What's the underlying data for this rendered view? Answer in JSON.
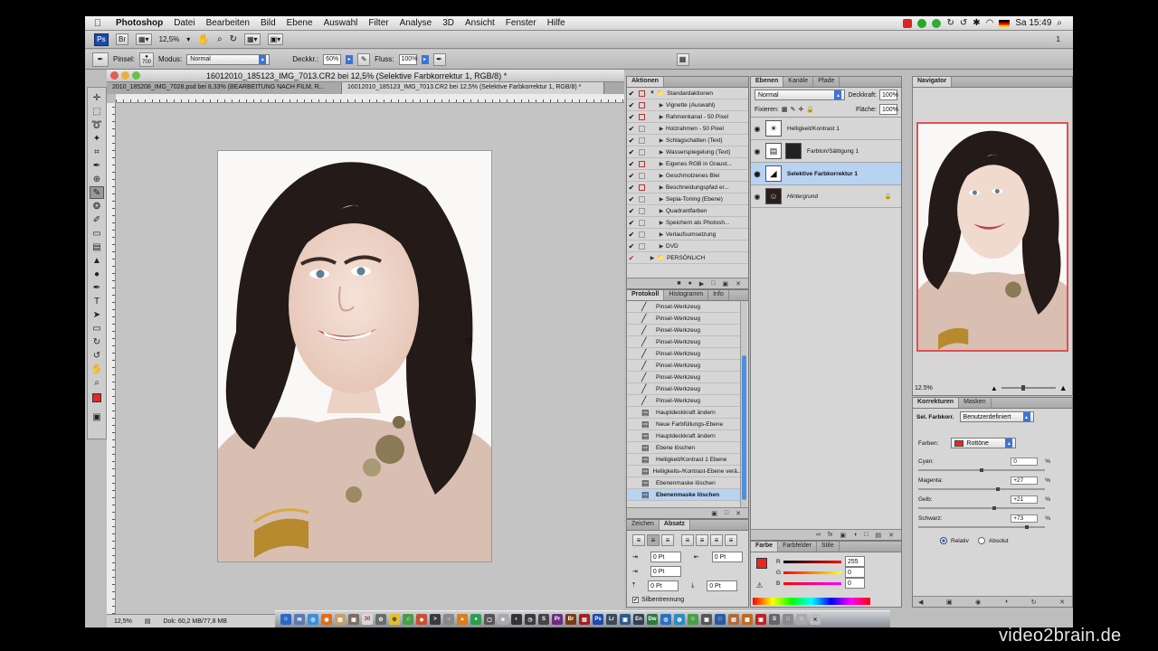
{
  "menubar": {
    "app_name": "Photoshop",
    "menus": [
      "Datei",
      "Bearbeiten",
      "Bild",
      "Ebene",
      "Auswahl",
      "Filter",
      "Analyse",
      "3D",
      "Ansicht",
      "Fenster",
      "Hilfe"
    ],
    "clock": "Sa 15:49"
  },
  "appbar": {
    "logo": "Ps",
    "zoom": "12,5%",
    "workspace": "1"
  },
  "options": {
    "brush_label": "Pinsel:",
    "brush_size": "700",
    "mode_label": "Modus:",
    "mode_value": "Normal",
    "opacity_label": "Deckkr.:",
    "opacity_value": "60%",
    "flow_label": "Fluss:",
    "flow_value": "100%"
  },
  "document": {
    "title": "16012010_185123_IMG_7013.CR2 bei 12,5% (Selektive Farbkorrektur 1, RGB/8) *",
    "tabs": [
      "2010_185208_IMG_7028.psd bei 8,33% (BEARBEITUNG NACH FILM, R...",
      "16012010_185123_IMG_7013.CR2 bei 12,5% (Selektive Farbkorrektur 1, RGB/8) *"
    ],
    "status_zoom": "12,5%",
    "status_doc": "Dok: 60,2 MB/77,8 MB"
  },
  "actions": {
    "tab": "Aktionen",
    "items": [
      {
        "label": "Standardaktionen",
        "folder": true
      },
      {
        "label": "Vignette (Auswahl)"
      },
      {
        "label": "Rahmenkanal - 50 Pixel"
      },
      {
        "label": "Holzrahmen - 50 Pixel"
      },
      {
        "label": "Schlagschatten (Text)"
      },
      {
        "label": "Wasserspiegelung (Text)"
      },
      {
        "label": "Eigenes RGB in Graust..."
      },
      {
        "label": "Geschmolzenes Blei"
      },
      {
        "label": "Beschneidungspfad er..."
      },
      {
        "label": "Sepia-Toning (Ebene)"
      },
      {
        "label": "Quadrantfarben"
      },
      {
        "label": "Speichern als Photosh..."
      },
      {
        "label": "Verlaufsumsetzung"
      },
      {
        "label": "DVD"
      },
      {
        "label": "PERSÖNLICH",
        "folder": true
      }
    ]
  },
  "history": {
    "tabs": [
      "Protokoll",
      "Histogramm",
      "Info"
    ],
    "items": [
      "Pinsel-Werkzeug",
      "Pinsel-Werkzeug",
      "Pinsel-Werkzeug",
      "Pinsel-Werkzeug",
      "Pinsel-Werkzeug",
      "Pinsel-Werkzeug",
      "Pinsel-Werkzeug",
      "Pinsel-Werkzeug",
      "Pinsel-Werkzeug",
      "Hauptdeckkraft ändern",
      "Neue Farbfüllungs-Ebene",
      "Hauptdeckkraft ändern",
      "Ebene löschen",
      "Helligkeit/Kontrast 1 Ebene",
      "Helligkeits-/Kontrast-Ebene verä...",
      "Ebenenmaske löschen",
      "Ebenenmaske löschen"
    ]
  },
  "text_panel": {
    "tabs": [
      "Zeichen",
      "Absatz"
    ],
    "fields": [
      "0 Pt",
      "0 Pt",
      "0 Pt",
      "0 Pt",
      "0 Pt"
    ],
    "hyphenation": "Silbentrennung"
  },
  "layers": {
    "tabs": [
      "Ebenen",
      "Kanäle",
      "Pfade"
    ],
    "blend_mode": "Normal",
    "opacity_label": "Deckkraft:",
    "opacity": "100%",
    "lock_label": "Fixieren:",
    "fill_label": "Fläche:",
    "fill": "100%",
    "items": [
      {
        "name": "Helligkeit/Kontrast 1"
      },
      {
        "name": "Farbton/Sättigung 1"
      },
      {
        "name": "Selektive Farbkorrektur 1"
      },
      {
        "name": "Hintergrund"
      }
    ]
  },
  "color_panel": {
    "tabs": [
      "Farbe",
      "Farbfelder",
      "Stile"
    ],
    "r_label": "R",
    "r": "255",
    "g_label": "G",
    "g": "0",
    "b_label": "B",
    "b": "0"
  },
  "navigator": {
    "tab": "Navigator",
    "zoom": "12.5%"
  },
  "corrections": {
    "tabs": [
      "Korrekturen",
      "Masken"
    ],
    "adjust_label": "Sel. Farbkorr.",
    "preset": "Benutzerdefiniert",
    "colors_label": "Farben:",
    "colors_value": "Rottöne",
    "sliders": [
      {
        "label": "Cyan:",
        "value": "0",
        "level": 0.5
      },
      {
        "label": "Magenta:",
        "value": "+27",
        "level": 0.63
      },
      {
        "label": "Gelb:",
        "value": "+21",
        "level": 0.6
      },
      {
        "label": "Schwarz:",
        "value": "+73",
        "level": 0.86
      }
    ],
    "relative": "Relativ",
    "absolute": "Absolut"
  },
  "watermark": "video2brain.de"
}
